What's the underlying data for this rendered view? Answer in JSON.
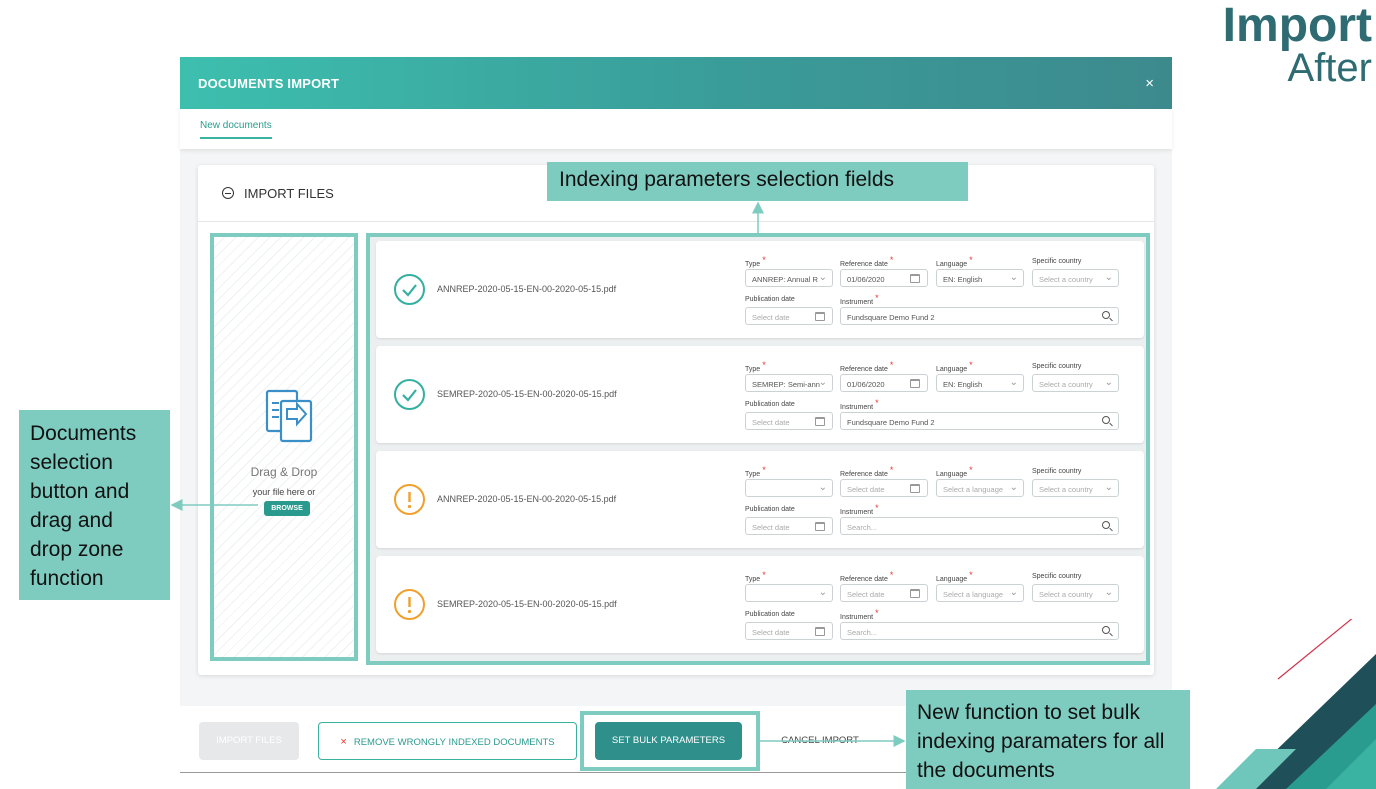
{
  "slide": {
    "title": "Import",
    "subtitle": "After"
  },
  "modal": {
    "title": "DOCUMENTS IMPORT",
    "close": "×",
    "tab": "New documents",
    "section_title": "IMPORT FILES"
  },
  "dropzone": {
    "heading": "Drag & Drop",
    "sub": "your file here or",
    "browse": "BROWSE"
  },
  "labels": {
    "type": "Type",
    "reference_date": "Reference date",
    "language": "Language",
    "specific_country": "Specific country",
    "publication_date": "Publication date",
    "instrument": "Instrument",
    "required_mark": "*"
  },
  "documents": [
    {
      "filename": "ANNREP-2020-05-15-EN-00-2020-05-15.pdf",
      "status": "ok",
      "type": "ANNREP: Annual R",
      "reference_date": "01/06/2020",
      "language": "EN: English",
      "country": "Select a country",
      "publication_date": "Select date",
      "instrument": "Fundsquare Demo Fund 2"
    },
    {
      "filename": "SEMREP-2020-05-15-EN-00-2020-05-15.pdf",
      "status": "ok",
      "type": "SEMREP: Semi-ann",
      "reference_date": "01/06/2020",
      "language": "EN: English",
      "country": "Select a country",
      "publication_date": "Select date",
      "instrument": "Fundsquare Demo Fund 2"
    },
    {
      "filename": "ANNREP-2020-05-15-EN-00-2020-05-15.pdf",
      "status": "warn",
      "type": "",
      "reference_date": "Select date",
      "language": "Select a language",
      "country": "Select a country",
      "publication_date": "Select date",
      "instrument": "Search..."
    },
    {
      "filename": "SEMREP-2020-05-15-EN-00-2020-05-15.pdf",
      "status": "warn",
      "type": "",
      "reference_date": "Select date",
      "language": "Select a language",
      "country": "Select a country",
      "publication_date": "Select date",
      "instrument": "Search..."
    }
  ],
  "footer": {
    "import_files": "IMPORT FILES",
    "remove_wrong": "REMOVE WRONGLY INDEXED DOCUMENTS",
    "remove_icon": "×",
    "set_bulk": "SET BULK PARAMETERS",
    "cancel": "CANCEL IMPORT"
  },
  "callouts": {
    "indexing": "Indexing parameters selection fields",
    "documents": "Documents selection button and drag and drop zone function",
    "bulk": "New function to set bulk indexing paramaters for all the documents"
  },
  "colors": {
    "teal": "#3bb3a2",
    "callout": "#7ecbc0",
    "dark_teal": "#2e6b72",
    "ok": "#34b0a1",
    "warn": "#f0a02b",
    "required": "#e53935"
  }
}
